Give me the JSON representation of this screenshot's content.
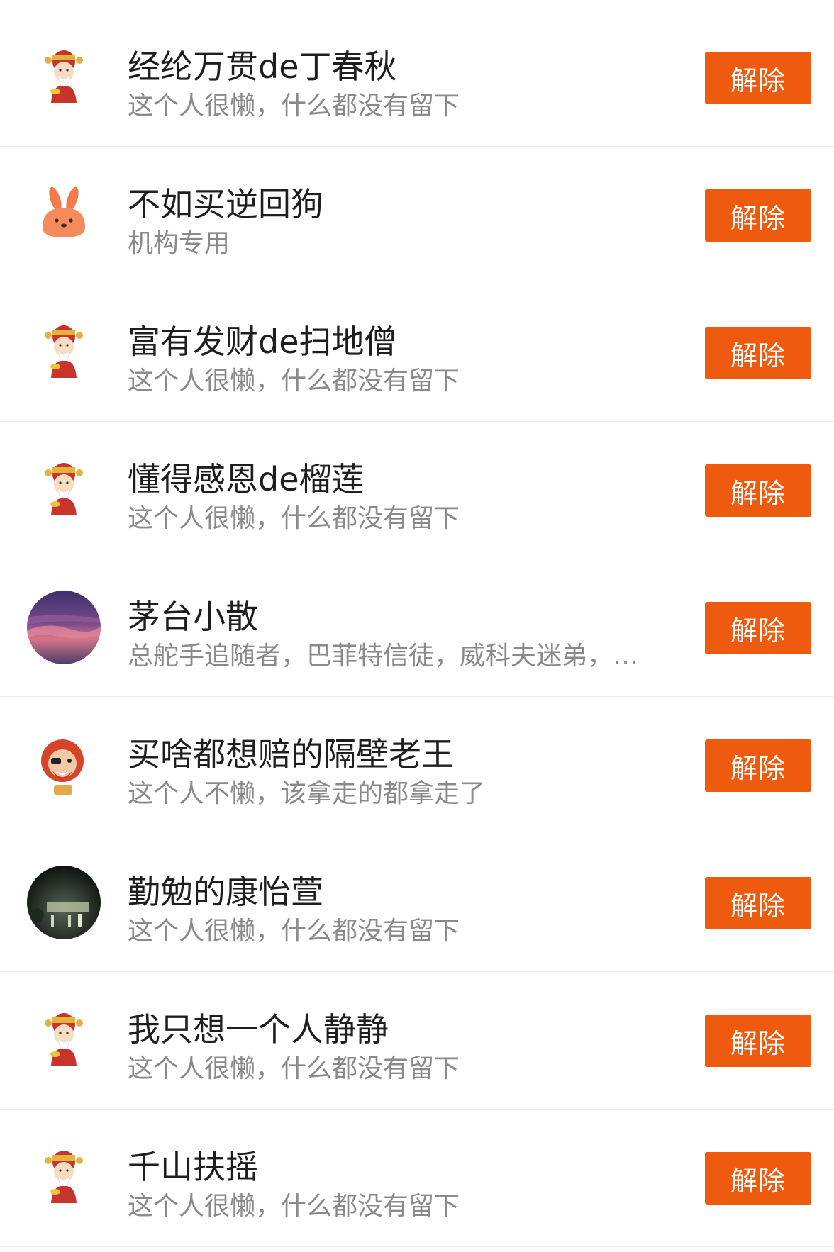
{
  "blocked_users": [
    {
      "name": "经纶万贯de丁春秋",
      "bio": "这个人很懒，什么都没有留下",
      "avatar": "fortune-god-avatar",
      "action": "解除"
    },
    {
      "name": "不如买逆回狗",
      "bio": "机构专用",
      "avatar": "bunny-avatar",
      "action": "解除"
    },
    {
      "name": "富有发财de扫地僧",
      "bio": "这个人很懒，什么都没有留下",
      "avatar": "fortune-god-avatar",
      "action": "解除"
    },
    {
      "name": "懂得感恩de榴莲",
      "bio": "这个人很懒，什么都没有留下",
      "avatar": "fortune-god-avatar",
      "action": "解除"
    },
    {
      "name": "茅台小散",
      "bio": "总舵手追随者，巴菲特信徒，威科夫迷弟，…",
      "avatar": "sunset-photo-avatar",
      "action": "解除"
    },
    {
      "name": "买啥都想赔的隔壁老王",
      "bio": "这个人不懒，该拿走的都拿走了",
      "avatar": "pirate-cartoon-avatar",
      "action": "解除"
    },
    {
      "name": "勤勉的康怡萱",
      "bio": "这个人很懒，什么都没有留下",
      "avatar": "night-photo-avatar",
      "action": "解除"
    },
    {
      "name": "我只想一个人静静",
      "bio": "这个人很懒，什么都没有留下",
      "avatar": "fortune-god-avatar",
      "action": "解除"
    },
    {
      "name": "千山扶摇",
      "bio": "这个人很懒，什么都没有留下",
      "avatar": "fortune-god-avatar",
      "action": "解除"
    }
  ],
  "colors": {
    "accent": "#ee5a0e",
    "name_text": "#1e1e1e",
    "bio_text": "#8a8a8a"
  }
}
